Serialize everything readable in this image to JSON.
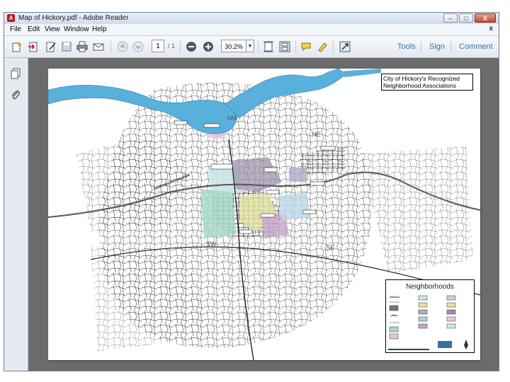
{
  "window": {
    "title": "Map of Hickory.pdf - Adobe Reader",
    "app_icon": "adobe-reader-icon",
    "controls": {
      "minimize": "–",
      "maximize": "□",
      "close": "X"
    }
  },
  "menubar": {
    "items": [
      "File",
      "Edit",
      "View",
      "Window",
      "Help"
    ],
    "close_glyph": "x"
  },
  "toolbar": {
    "current_page": "1",
    "total_pages": "/ 1",
    "zoom": "30.2%",
    "zoom_dropdown": "▼",
    "right_links": [
      "Tools",
      "Sign",
      "Comment"
    ],
    "icons": [
      "create-icon",
      "export-icon",
      "edit-icon",
      "save-icon",
      "print-icon",
      "email-icon",
      "previous-page-icon",
      "next-page-icon",
      "zoom-out-icon",
      "zoom-in-icon",
      "fit-page-icon",
      "scroll-mode-icon",
      "comment-icon",
      "highlight-icon",
      "full-screen-icon"
    ]
  },
  "left_panel": {
    "icons": [
      "pages-icon",
      "attachments-icon"
    ]
  },
  "document": {
    "map_title_line1": "City of Hickory's Recognized",
    "map_title_line2": "Neighborhood Associations",
    "legend_title": "Neighborhoods",
    "area_labels": [
      "NW",
      "NE",
      "SW",
      "SE"
    ]
  },
  "colors": {
    "window_frame": "#d8e2ee",
    "doc_background": "#6b6b6b",
    "water": "#5ab0dc",
    "link": "#3b6ea5"
  }
}
